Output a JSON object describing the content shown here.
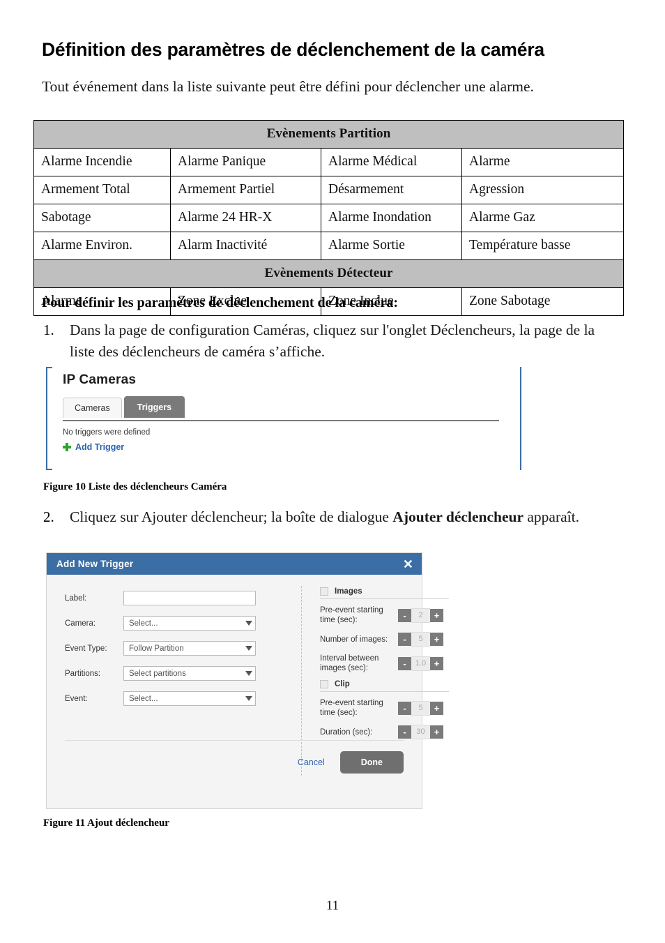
{
  "page": {
    "title": "Définition des paramètres de déclenchement de la caméra",
    "intro": "Tout événement dans la liste suivante peut être défini pour déclencher une alarme.",
    "lead_bold": "Pour définir les paramètres de déclenchement de la caméra:",
    "page_number": "11"
  },
  "events_table": {
    "sections": [
      {
        "header": "Evènements Partition",
        "rows": [
          [
            "Alarme Incendie",
            "Alarme Panique",
            "Alarme Médical",
            "Alarme"
          ],
          [
            "Armement Total",
            "Armement Partiel",
            "Désarmement",
            "Agression"
          ],
          [
            "Sabotage",
            "Alarme 24 HR-X",
            "Alarme Inondation",
            "Alarme Gaz"
          ],
          [
            "Alarme Environ.",
            "Alarm Inactivité",
            "Alarme Sortie",
            "Température basse"
          ]
        ]
      },
      {
        "header": "Evènements Détecteur",
        "rows": [
          [
            "Alarme",
            "Zone Exclue",
            "Zone Inclue",
            "Zone Sabotage"
          ]
        ]
      }
    ]
  },
  "steps": [
    {
      "number": "1.",
      "text": "Dans la page de configuration Caméras, cliquez sur l'onglet Déclencheurs, la page de la liste des déclencheurs de caméra s’affiche."
    },
    {
      "number": "2.",
      "text_before": "Cliquez sur Ajouter déclencheur; la boîte de dialogue ",
      "text_bold": "Ajouter déclencheur",
      "text_after": " apparaît."
    }
  ],
  "figure_10": {
    "caption": "Figure 10 Liste des déclencheurs Caméra",
    "app_title": "IP Cameras",
    "tabs": [
      {
        "label": "Cameras",
        "active": false
      },
      {
        "label": "Triggers",
        "active": true
      }
    ],
    "empty_message": "No triggers were defined",
    "add_trigger_label": "Add Trigger",
    "colors": {
      "active_tab_bg": "#7a7a7a",
      "link": "#2d62b0",
      "plus": "#2ea52e",
      "frame": "#3a6ea5"
    }
  },
  "figure_11": {
    "caption": "Figure 11 Ajout déclencheur",
    "dialog": {
      "title": "Add New Trigger",
      "close_glyph": "✕",
      "titlebar_color": "#3a6ea5",
      "fields": [
        {
          "label": "Label:",
          "value": "",
          "type": "text"
        },
        {
          "label": "Camera:",
          "value": "Select...",
          "type": "select"
        },
        {
          "label": "Event Type:",
          "value": "Follow Partition",
          "type": "select"
        },
        {
          "label": "Partitions:",
          "value": "Select partitions",
          "type": "select"
        },
        {
          "label": "Event:",
          "value": "Select...",
          "type": "select"
        }
      ],
      "groups": [
        {
          "name": "Images",
          "checked": false,
          "steppers": [
            {
              "label": "Pre-event starting time (sec):",
              "value": "2",
              "minus": "-",
              "plus": "+"
            },
            {
              "label": "Number of images:",
              "value": "5",
              "minus": "-",
              "plus": "+"
            },
            {
              "label": "Interval between images (sec):",
              "value": "1.0",
              "minus": "-",
              "plus": "+"
            }
          ]
        },
        {
          "name": "Clip",
          "checked": false,
          "steppers": [
            {
              "label": "Pre-event starting time (sec):",
              "value": "5",
              "minus": "-",
              "plus": "+"
            },
            {
              "label": "Duration (sec):",
              "value": "30",
              "minus": "-",
              "plus": "+"
            }
          ]
        }
      ],
      "cancel_label": "Cancel",
      "done_label": "Done"
    }
  }
}
